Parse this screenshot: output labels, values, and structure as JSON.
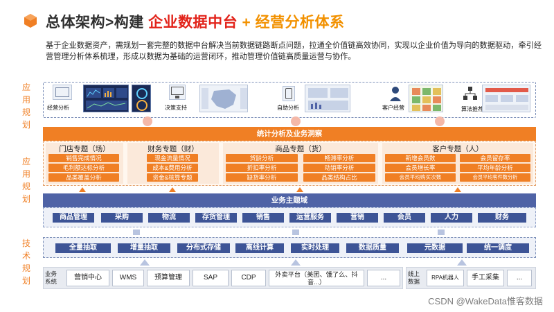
{
  "header": {
    "title_part1": "总体架构>构建",
    "title_part2": "企业数据中台",
    "title_plus": "+",
    "title_part3": "经营分析体系",
    "intro": "基于企业数据资产，需规划一套完整的数据中台解决当前数据链路断点问题，拉通全价值链高效协同，实现以企业价值为导向的数据驱动，牵引经营管理分析体系梳理，形成以数据为基础的运营闭环，推动管理价值链高质量运营与协作。"
  },
  "side_labels": {
    "application": "应用规划",
    "middle": "应用规划",
    "technology": "技术规划"
  },
  "applications": [
    {
      "label": "经营分析"
    },
    {
      "label": "决策支持"
    },
    {
      "label": "自助分析"
    },
    {
      "label": "客户经营"
    },
    {
      "label": "算法推荐"
    }
  ],
  "analysis": {
    "bar_title": "统计分析及业务洞察",
    "topics": [
      {
        "title": "门店专题（场）",
        "items": [
          "销售完成情况",
          "毛利额达标分析",
          "品类覆盖分析"
        ]
      },
      {
        "title": "财务专题（财）",
        "items": [
          "现金流量情况",
          "成本&费用分析",
          "资金&核算专题"
        ]
      },
      {
        "title": "商品专题（货）",
        "items": [
          "货龄分析",
          "畅滞率分析",
          "折扣率分析",
          "动销率分析",
          "缺货率分析",
          "品类结构占比"
        ]
      },
      {
        "title": "客户专题（人）",
        "items": [
          "新增会员数",
          "会员留存率",
          "会员增长率",
          "平均年龄分析",
          "会员平均购买次数",
          "会员平均客件数分析"
        ]
      }
    ]
  },
  "business": {
    "bar_title": "业务主题域",
    "items": [
      "商品管理",
      "采购",
      "物流",
      "存货管理",
      "销售",
      "运营服务",
      "营销",
      "会员",
      "人力",
      "财务"
    ]
  },
  "technology": {
    "items": [
      "全量抽取",
      "增量抽取",
      "分布式存储",
      "离线计算",
      "实时处理",
      "数据质量",
      "元数据",
      "统一调度"
    ]
  },
  "sources": {
    "business_label": "业务系统",
    "business_items": [
      "营销中心",
      "WMS",
      "预算管理",
      "SAP",
      "CDP",
      "外卖平台（美团、饿了么、抖音...）",
      "..."
    ],
    "offline_label": "线上数据",
    "offline_items": [
      "RPA机器人",
      "手工采集",
      "..."
    ]
  },
  "watermark": "CSDN @WakeData惟客数据",
  "colors": {
    "orange": "#f07f24",
    "red": "#e2231a",
    "navy": "#3d5496",
    "blue_bar": "#4f63a6"
  }
}
